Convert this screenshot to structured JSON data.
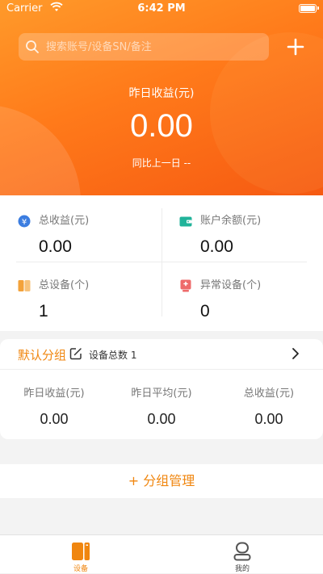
{
  "status_bar": {
    "carrier": "Carrier",
    "time": "6:42 PM"
  },
  "search": {
    "placeholder": "搜索账号/设备SN/备注"
  },
  "hero": {
    "label": "昨日收益(元)",
    "value": "0.00",
    "compare": "同比上一日 --"
  },
  "stats": [
    {
      "label": "总收益(元)",
      "value": "0.00",
      "icon": "yen-icon",
      "color": "#3b7de0"
    },
    {
      "label": "账户余额(元)",
      "value": "0.00",
      "icon": "wallet-icon",
      "color": "#21b39a"
    },
    {
      "label": "总设备(个)",
      "value": "1",
      "icon": "device-icon",
      "color": "#f3a23a"
    },
    {
      "label": "异常设备(个)",
      "value": "0",
      "icon": "alert-device-icon",
      "color": "#ee6a6a"
    }
  ],
  "group": {
    "name": "默认分组",
    "device_count": "设备总数 1",
    "columns": [
      {
        "label": "昨日收益(元)",
        "value": "0.00"
      },
      {
        "label": "昨日平均(元)",
        "value": "0.00"
      },
      {
        "label": "总收益(元)",
        "value": "0.00"
      }
    ]
  },
  "manage": {
    "label": "+ 分组管理"
  },
  "tabs": [
    {
      "label": "设备",
      "active": true
    },
    {
      "label": "我的",
      "active": false
    }
  ],
  "colors": {
    "accent": "#f0860f",
    "hero_start": "#ff9a2a",
    "hero_end": "#f65a12"
  }
}
